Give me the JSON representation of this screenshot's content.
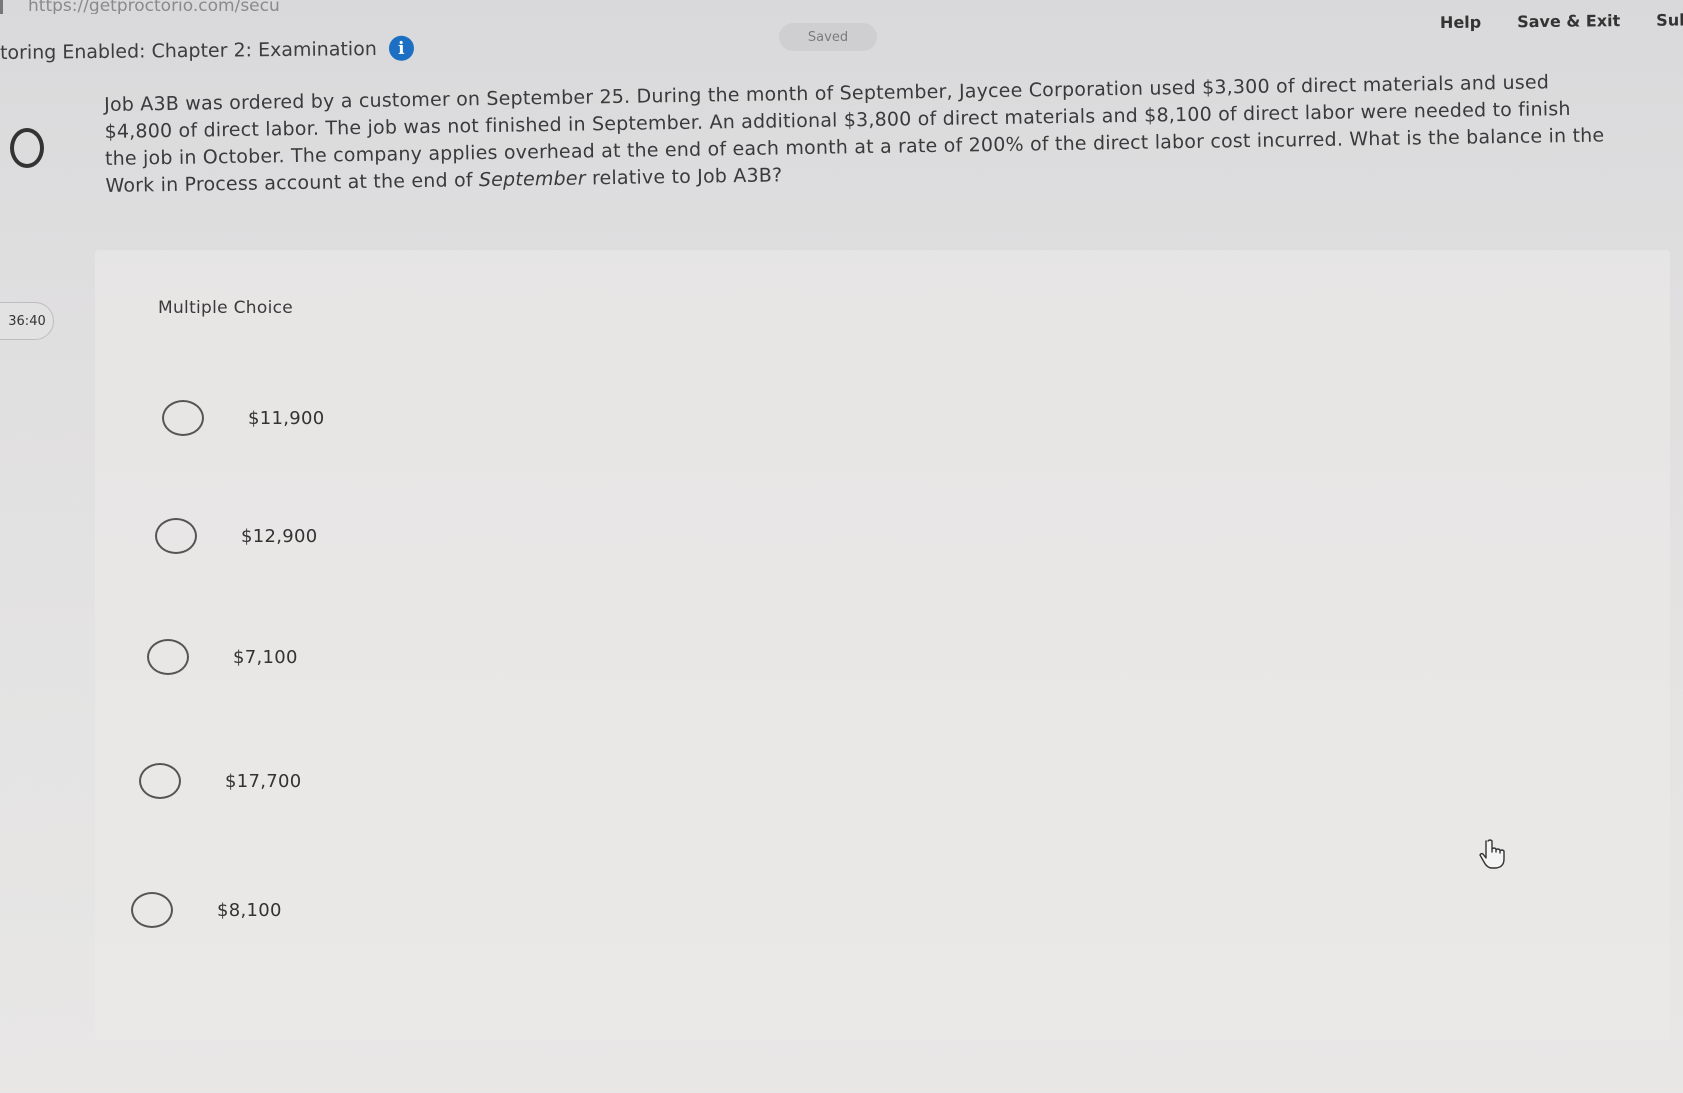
{
  "browser": {
    "url_fragment": "https://getproctorio.com/secu"
  },
  "header": {
    "title": "toring Enabled: Chapter 2: Examination",
    "saved_label": "Saved",
    "help_label": "Help",
    "save_exit_label": "Save & Exit",
    "submit_label": "Sub"
  },
  "sidebar": {
    "timer": "36:40"
  },
  "question": {
    "line1": "Job A3B was ordered by a customer on September 25. During the month of September, Jaycee Corporation used $3,300 of direct materials and used",
    "line2": "$4,800 of direct labor. The job was not finished in September. An additional $3,800 of direct materials and $8,100 of direct labor were needed to finish",
    "line3": "the job in October. The company applies overhead at the end of each month at a rate of 200% of the direct labor cost incurred. What is the balance in the",
    "line4_pre": "Work in Process account at the end of ",
    "line4_em": "September",
    "line4_post": " relative to Job A3B?"
  },
  "choices": {
    "label": "Multiple Choice",
    "options": [
      {
        "text": "$11,900"
      },
      {
        "text": "$12,900"
      },
      {
        "text": "$7,100"
      },
      {
        "text": "$17,700"
      },
      {
        "text": "$8,100"
      }
    ]
  },
  "icons": {
    "info": "info-icon",
    "cursor": "hand-pointer-icon"
  },
  "colors": {
    "info_icon": "#1c6fc2",
    "background": "#e0dfe0"
  }
}
